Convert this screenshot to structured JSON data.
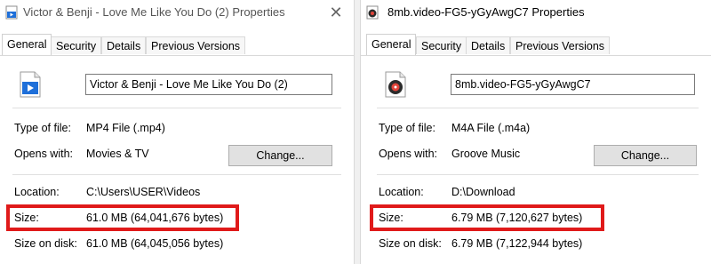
{
  "left": {
    "title": "Victor & Benji - Love Me Like You Do (2) Properties",
    "tabs": [
      "General",
      "Security",
      "Details",
      "Previous Versions"
    ],
    "file_name": "Victor & Benji - Love Me Like You Do (2)",
    "type_label": "Type of file:",
    "type_value": "MP4 File (.mp4)",
    "opens_label": "Opens with:",
    "opens_value": "Movies & TV",
    "change_label": "Change...",
    "location_label": "Location:",
    "location_value": "C:\\Users\\USER\\Videos",
    "size_label": "Size:",
    "size_value": "61.0 MB (64,041,676 bytes)",
    "disk_label": "Size on disk:",
    "disk_value": "61.0 MB (64,045,056 bytes)",
    "close_glyph": "✕",
    "icon": "video-file-icon"
  },
  "right": {
    "title": "8mb.video-FG5-yGyAwgC7 Properties",
    "tabs": [
      "General",
      "Security",
      "Details",
      "Previous Versions"
    ],
    "file_name": "8mb.video-FG5-yGyAwgC7",
    "type_label": "Type of file:",
    "type_value": "M4A File (.m4a)",
    "opens_label": "Opens with:",
    "opens_value": "Groove Music",
    "change_label": "Change...",
    "location_label": "Location:",
    "location_value": "D:\\Download",
    "size_label": "Size:",
    "size_value": "6.79 MB (7,120,627 bytes)",
    "disk_label": "Size on disk:",
    "disk_value": "6.79 MB (7,122,944 bytes)",
    "icon": "music-file-icon"
  },
  "colors": {
    "highlight": "#e01a1a",
    "accent": "#0078d7"
  }
}
